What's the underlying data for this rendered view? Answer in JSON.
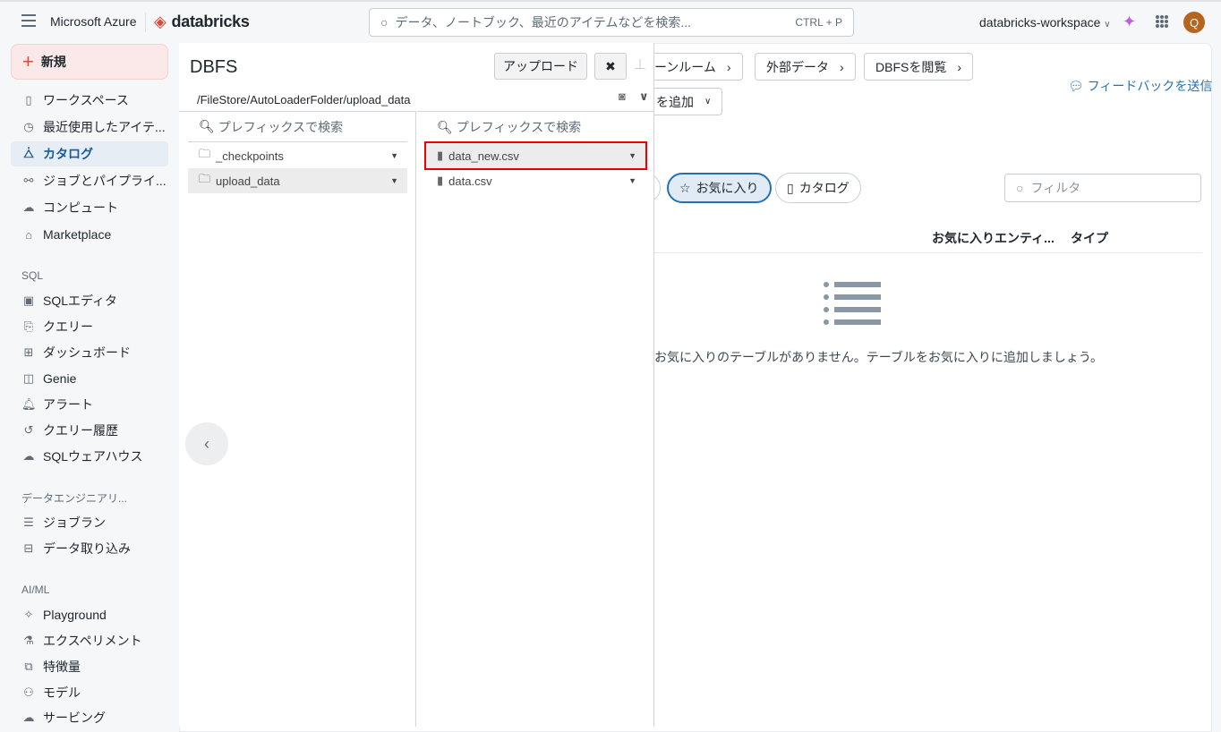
{
  "topbar": {
    "brand": "Microsoft Azure",
    "logo": "databricks",
    "search_placeholder": "データ、ノートブック、最近のアイテムなどを検索...",
    "shortcut": "CTRL + P",
    "workspace": "databricks-workspace",
    "avatar": "Q"
  },
  "sidebar": {
    "new_label": "新規",
    "items": [
      {
        "label": "ワークスペース",
        "icon": "workspace-icon"
      },
      {
        "label": "最近使用したアイテ...",
        "icon": "clock-icon"
      },
      {
        "label": "カタログ",
        "icon": "catalog-icon"
      },
      {
        "label": "ジョブとパイプライ...",
        "icon": "workflow-icon"
      },
      {
        "label": "コンピュート",
        "icon": "cloud-icon"
      },
      {
        "label": "Marketplace",
        "icon": "store-icon"
      }
    ],
    "sql_header": "SQL",
    "sql_items": [
      {
        "label": "SQLエディタ"
      },
      {
        "label": "クエリー"
      },
      {
        "label": "ダッシュボード"
      },
      {
        "label": "Genie"
      },
      {
        "label": "アラート"
      },
      {
        "label": "クエリー履歴"
      },
      {
        "label": "SQLウェアハウス"
      }
    ],
    "de_header": "データエンジニアリ...",
    "de_items": [
      {
        "label": "ジョブラン"
      },
      {
        "label": "データ取り込み"
      }
    ],
    "ml_header": "AI/ML",
    "ml_items": [
      {
        "label": "Playground"
      },
      {
        "label": "エクスペリメント"
      },
      {
        "label": "特徴量"
      },
      {
        "label": "モデル"
      },
      {
        "label": "サービング"
      }
    ]
  },
  "background": {
    "btn_cleanroom": "ーンルーム",
    "btn_external": "外部データ",
    "btn_dbfs": "DBFSを閲覧",
    "btn_add": "を追加",
    "feedback": "フィードバックを送信",
    "chip_favorites": "お気に入り",
    "chip_catalog": "カタログ",
    "filter_placeholder": "フィルタ",
    "col_entity": "お気に入りエンティ...",
    "col_type": "タイプ",
    "empty_message": "お気に入りのテーブルがありません。テーブルをお気に入りに追加しましょう。"
  },
  "modal": {
    "title": "DBFS",
    "upload": "アップロード",
    "path": "/FileStore/AutoLoaderFolder/upload_data",
    "left": {
      "search_placeholder": "プレフィックスで検索",
      "items": [
        {
          "name": "_checkpoints",
          "selected": false
        },
        {
          "name": "upload_data",
          "selected": true
        }
      ]
    },
    "right": {
      "search_placeholder": "プレフィックスで検索",
      "items": [
        {
          "name": "data_new.csv",
          "selected": true,
          "highlighted": true
        },
        {
          "name": "data.csv",
          "selected": false
        }
      ]
    }
  },
  "colors": {
    "accent": "#2272b4",
    "highlight": "#ee0000",
    "avatar": "#b5651d"
  }
}
